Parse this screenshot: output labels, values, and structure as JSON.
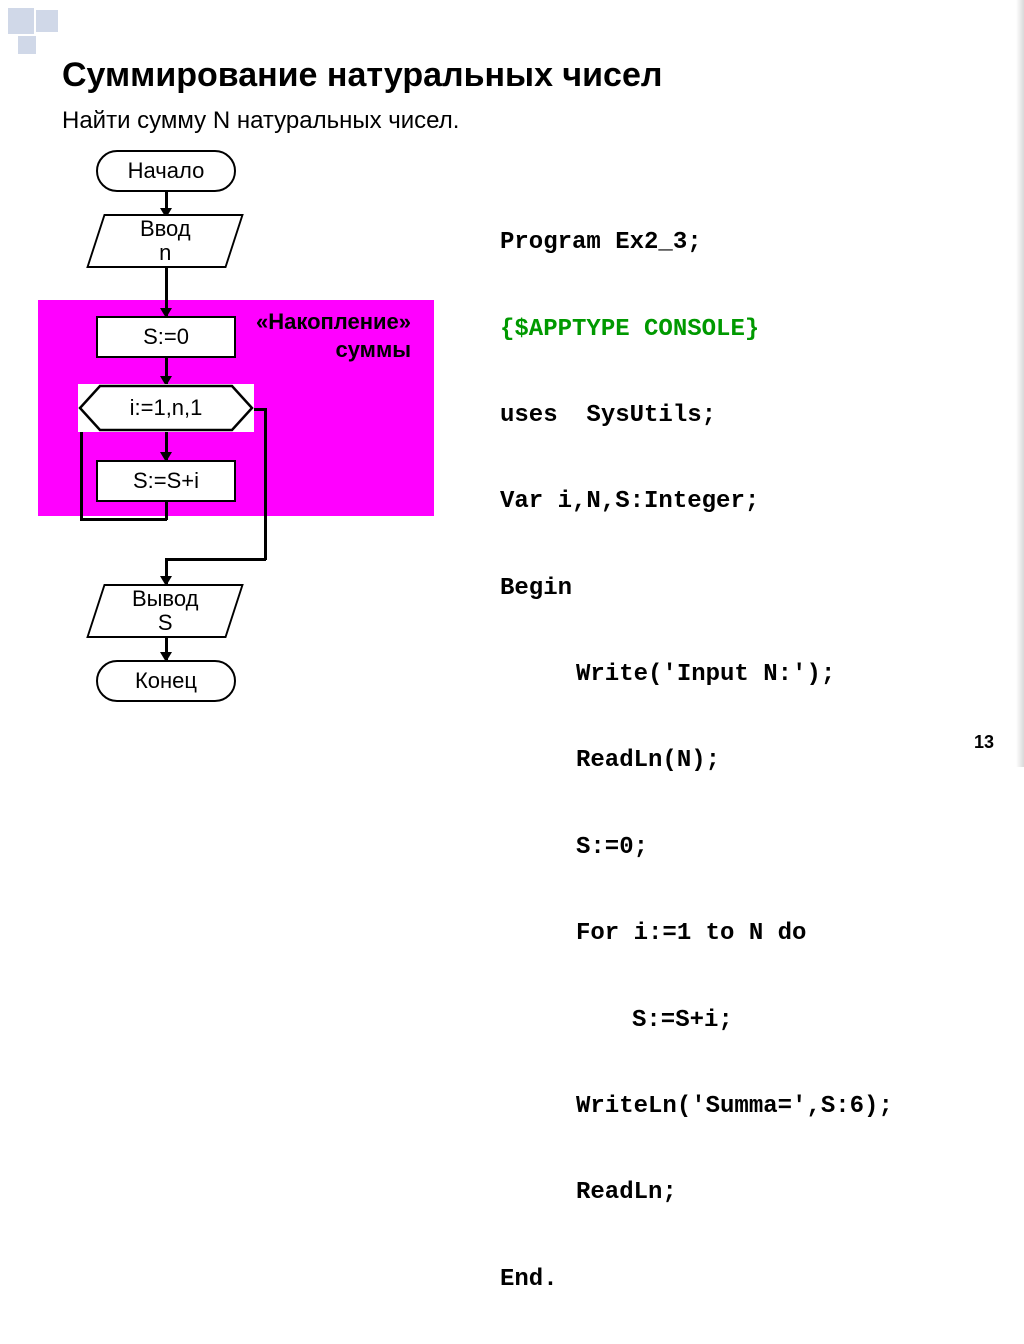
{
  "title": "Суммирование натуральных чисел",
  "subtitle": "Найти сумму N натуральных чисел.",
  "flow": {
    "start": "Начало",
    "input": "Ввод\nn",
    "init": "S:=0",
    "loop": "i:=1,n,1",
    "body": "S:=S+i",
    "output": "Вывод\nS",
    "end": "Конец",
    "accum1": "«Накопление»",
    "accum2": "суммы"
  },
  "code": {
    "l1": "Program Ex2_3;",
    "l2": "{$APPTYPE CONSOLE}",
    "l3": "uses  SysUtils;",
    "l4": "Var i,N,S:Integer;",
    "l5": "Begin",
    "l6": "Write('Input N:');",
    "l7": "ReadLn(N);",
    "l8": "S:=0;",
    "l9": "For i:=1 to N do",
    "l10": "S:=S+i;",
    "l11": "WriteLn('Summa=',S:6);",
    "l12": "ReadLn;",
    "l13": "End."
  },
  "page_number": "13"
}
